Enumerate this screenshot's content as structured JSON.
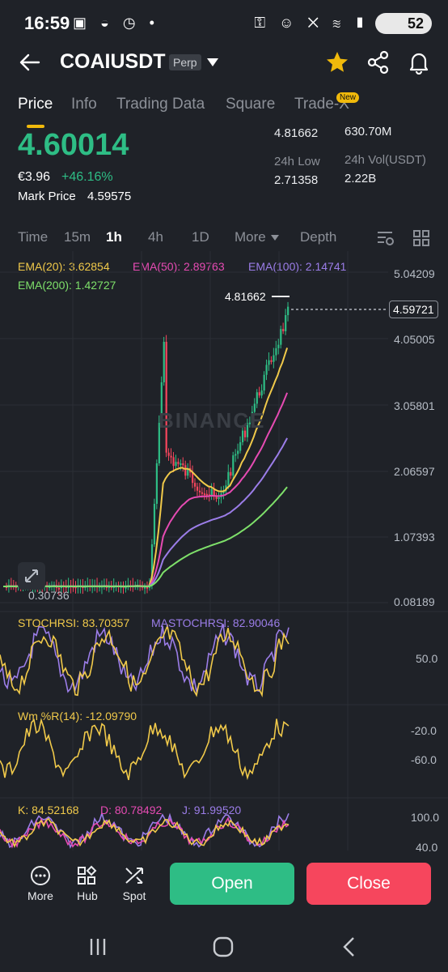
{
  "status_bar": {
    "time": "16:59",
    "battery": "52"
  },
  "header": {
    "symbol": "COAIUSDT",
    "contract_type": "Perp"
  },
  "tabs": [
    {
      "label": "Price",
      "active": true
    },
    {
      "label": "Info"
    },
    {
      "label": "Trading Data"
    },
    {
      "label": "Square"
    },
    {
      "label": "Trade-X",
      "badge": "New"
    }
  ],
  "ticker": {
    "last_price": "4.60014",
    "fiat_price": "€3.96",
    "change_pct": "+46.16%",
    "mark_price_label": "Mark Price",
    "mark_price": "4.59575",
    "high_value": "4.81662",
    "high_vol_value": "630.70M",
    "low_label": "24h Low",
    "low_value": "2.71358",
    "vol_usdt_label": "24h Vol(USDT)",
    "vol_usdt_value": "2.22B"
  },
  "timeframes": {
    "time": "Time",
    "m15": "15m",
    "h1": "1h",
    "h4": "4h",
    "d1": "1D",
    "more": "More",
    "depth": "Depth",
    "selected": "1h"
  },
  "ema": {
    "ema20": "EMA(20): 3.62854",
    "ema50": "EMA(50): 2.89763",
    "ema100": "EMA(100): 2.14741",
    "ema200": "EMA(200): 1.42727"
  },
  "main_chart": {
    "y_ticks": [
      "5.04209",
      "4.05005",
      "3.05801",
      "2.06597",
      "1.07393",
      "0.08189"
    ],
    "high_marker": "4.81662",
    "low_marker": "0.30736",
    "current_price": "4.59721",
    "watermark": "BINANCE"
  },
  "stochrsi": {
    "label": "STOCHRSI: 83.70357",
    "ma_label": "MASTOCHRSI: 82.90046",
    "tick": "50.0"
  },
  "wr": {
    "label": "Wm %R(14): -12.09790",
    "ticks": [
      "-20.0",
      "-60.0"
    ]
  },
  "kdj": {
    "k": "K: 84.52168",
    "d": "D: 80.78492",
    "j": "J: 91.99520",
    "ticks": [
      "100.0",
      "40.0"
    ]
  },
  "colors": {
    "up": "#2ebd85",
    "down": "#f6465d",
    "ema20": "#f0c94a",
    "ema50": "#e64bb3",
    "ema100": "#9b7de8",
    "ema200": "#7ee06a",
    "accent": "#f0b90b"
  },
  "bottom_bar": {
    "more": "More",
    "hub": "Hub",
    "spot": "Spot",
    "open": "Open",
    "close": "Close"
  }
}
